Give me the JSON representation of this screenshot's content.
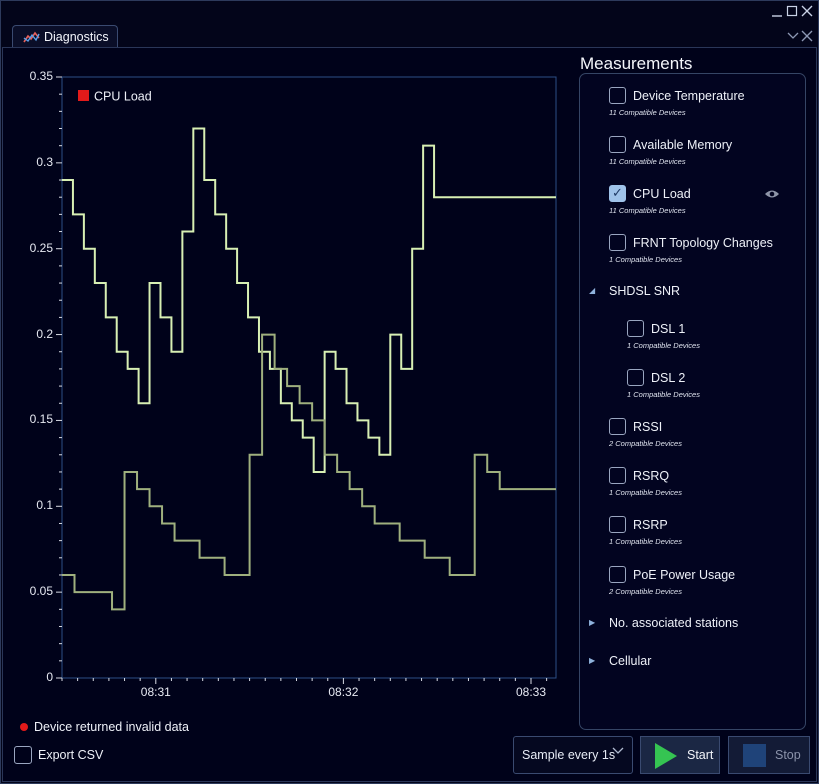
{
  "window": {
    "controls": [
      "minimize",
      "maximize",
      "close"
    ]
  },
  "tab": {
    "title": "Diagnostics",
    "icon": "diagnostics-chart-icon"
  },
  "chart_data": {
    "type": "line",
    "legend": "CPU Load",
    "legend_color": "#e21a1a",
    "legend_placement": "top-left",
    "ylim": [
      0,
      0.35
    ],
    "y_ticks": [
      "0",
      "0.05",
      "0.1",
      "0.15",
      "0.2",
      "0.25",
      "0.3",
      "0.35"
    ],
    "x_ticks": [
      "08:31",
      "08:32",
      "08:33"
    ],
    "x_tick_positions_seconds": [
      30,
      90,
      150
    ],
    "xlim_seconds": [
      0,
      158
    ],
    "series": [
      {
        "color": "#d7efb3",
        "step": true,
        "x_seconds": [
          0,
          3.5,
          7,
          10.5,
          14,
          17.5,
          21,
          24.5,
          28,
          31.5,
          35,
          38.5,
          42,
          45.5,
          49,
          52.5,
          56,
          59.5,
          63,
          66.5,
          70,
          73.5,
          77,
          80.5,
          84,
          87.5,
          91,
          94.5,
          98,
          101.5,
          105,
          108.5,
          112,
          115.5,
          119,
          122.5,
          126,
          129.5,
          133,
          136.5,
          140,
          143.5,
          147,
          150.5,
          154
        ],
        "values": [
          0.29,
          0.27,
          0.25,
          0.23,
          0.21,
          0.19,
          0.18,
          0.16,
          0.23,
          0.21,
          0.19,
          0.26,
          0.32,
          0.29,
          0.27,
          0.25,
          0.23,
          0.21,
          0.19,
          0.18,
          0.16,
          0.15,
          0.14,
          0.12,
          0.19,
          0.18,
          0.16,
          0.15,
          0.14,
          0.13,
          0.2,
          0.18,
          0.25,
          0.31,
          0.28,
          0.28,
          0.28,
          0.28,
          0.28,
          0.28,
          0.28,
          0.28,
          0.28,
          0.28,
          0.28
        ]
      },
      {
        "color": "#9fb07e",
        "step": true,
        "x_seconds": [
          0,
          4,
          8,
          12,
          16,
          20,
          24,
          28,
          32,
          36,
          40,
          44,
          48,
          52,
          56,
          60,
          64,
          68,
          72,
          76,
          80,
          84,
          88,
          92,
          96,
          100,
          104,
          108,
          112,
          116,
          120,
          124,
          128,
          132,
          136,
          140,
          144,
          148,
          152,
          156
        ],
        "values": [
          0.06,
          0.05,
          0.05,
          0.05,
          0.04,
          0.12,
          0.11,
          0.1,
          0.09,
          0.08,
          0.08,
          0.07,
          0.07,
          0.06,
          0.06,
          0.13,
          0.2,
          0.18,
          0.17,
          0.16,
          0.15,
          0.13,
          0.12,
          0.11,
          0.1,
          0.09,
          0.09,
          0.08,
          0.08,
          0.07,
          0.07,
          0.06,
          0.06,
          0.13,
          0.12,
          0.11,
          0.11,
          0.11,
          0.11,
          0.11
        ]
      }
    ]
  },
  "measurements": {
    "title": "Measurements",
    "items": [
      {
        "label": "Device Temperature",
        "sub": "11 Compatible Devices",
        "checked": false
      },
      {
        "label": "Available Memory",
        "sub": "11 Compatible Devices",
        "checked": false
      },
      {
        "label": "CPU Load",
        "sub": "11 Compatible Devices",
        "checked": true,
        "visible_icon": "eye-icon"
      },
      {
        "label": "FRNT Topology Changes",
        "sub": "1 Compatible Devices",
        "checked": false
      },
      {
        "label": "SHDSL SNR",
        "group": true,
        "expanded": true
      },
      {
        "label": "DSL 1",
        "sub": "1 Compatible Devices",
        "checked": false
      },
      {
        "label": "DSL 2",
        "sub": "1 Compatible Devices",
        "checked": false
      },
      {
        "label": "RSSI",
        "sub": "2 Compatible Devices",
        "checked": false
      },
      {
        "label": "RSRQ",
        "sub": "1 Compatible Devices",
        "checked": false
      },
      {
        "label": "RSRP",
        "sub": "1 Compatible Devices",
        "checked": false
      },
      {
        "label": "PoE Power Usage",
        "sub": "2 Compatible Devices",
        "checked": false
      },
      {
        "label": "No. associated stations",
        "group": true,
        "expanded": false
      },
      {
        "label": "Cellular",
        "group": true,
        "expanded": false
      }
    ]
  },
  "status": {
    "text": "Device returned invalid data",
    "color": "#e21a1a"
  },
  "export": {
    "label": "Export CSV",
    "checked": false
  },
  "sample": {
    "value": "Sample every 1s"
  },
  "buttons": {
    "start": "Start",
    "stop": "Stop"
  }
}
